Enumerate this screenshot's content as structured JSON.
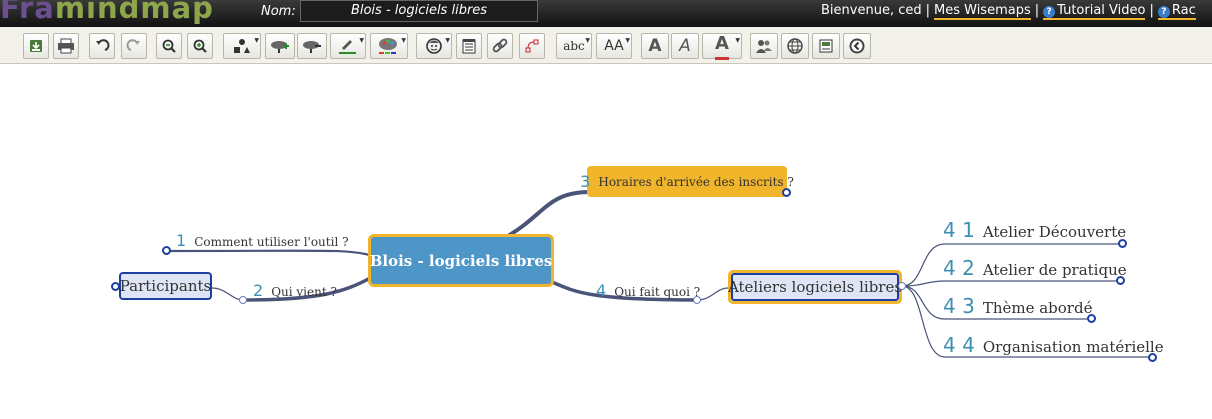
{
  "header": {
    "logo_part1": "Fra",
    "logo_part2": "mindmap",
    "name_label": "Nom:",
    "map_name": "Blois - logiciels libres",
    "welcome": "Bienvenue, ced",
    "link_my_maps": "Mes Wisemaps",
    "link_tutorial": "Tutorial Video",
    "link_shortcuts": "Rac",
    "help_icon_glyph": "?"
  },
  "toolbar": {
    "tools": [
      "save-icon",
      "print-icon",
      "undo-icon",
      "redo-icon",
      "zoom-out-icon",
      "zoom-in-icon",
      "topic-shape-icon",
      "add-topic-icon",
      "delete-topic-icon",
      "border-color-icon",
      "background-color-icon",
      "icon-face-icon",
      "note-icon",
      "link-icon",
      "relationship-icon",
      "font-type-icon",
      "font-size-icon",
      "bold-icon",
      "italic-icon",
      "font-color-icon",
      "share-icon",
      "publish-icon",
      "history-icon",
      "back-icon"
    ],
    "font_type_glyph": "abc",
    "font_size_glyph": "AA",
    "bold_glyph": "A",
    "italic_glyph": "A",
    "font_color_glyph": "A"
  },
  "colors": {
    "central_bg": "#4f96c8",
    "accent_border": "#f0b52a",
    "node_border": "#1d3fa0",
    "number_color": "#3f8fb3",
    "connector": "#4a5478"
  },
  "mindmap": {
    "central": "Blois - logiciels libres",
    "topic1": {
      "number": "1",
      "text": "Comment utiliser l'outil ?"
    },
    "topic2": {
      "number": "2",
      "text": "Qui vient ?"
    },
    "participants": "Participants",
    "topic3": {
      "number": "3",
      "text": "Horaires d'arrivée des inscrits ?"
    },
    "topic4": {
      "number": "4",
      "text": "Qui fait quoi ?"
    },
    "ateliers": "Ateliers logiciels libres",
    "subtopics": [
      {
        "number": "4 1",
        "text": "Atelier Découverte"
      },
      {
        "number": "4 2",
        "text": "Atelier de pratique"
      },
      {
        "number": "4 3",
        "text": "Thème abordé"
      },
      {
        "number": "4 4",
        "text": "Organisation matérielle"
      }
    ]
  }
}
